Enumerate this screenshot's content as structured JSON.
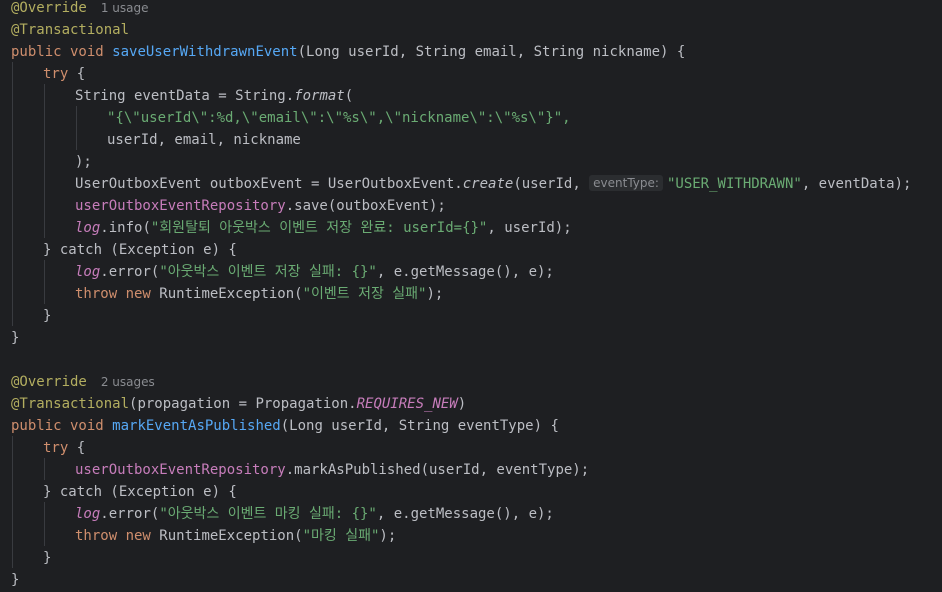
{
  "editor": {
    "method1": {
      "usage_hint": "1 usage",
      "annotations": [
        "@Override",
        "@Transactional"
      ],
      "signature_prefix": "public void ",
      "name": "saveUserWithdrawnEvent",
      "params": "(Long userId, String email, String nickname) {",
      "try_kw": "try",
      "line_eventdata": "String eventData = String.",
      "format_method": "format",
      "json_template": "\"{\\\"userId\\\":%d,\\\"email\\\":\\\"%s\\\",\\\"nickname\\\":\\\"%s\\\"}\",",
      "format_args": "userId, email, nickname",
      "close_paren": ");",
      "outbox_line_prefix": "UserOutboxEvent outboxEvent = UserOutboxEvent.",
      "create_method": "create",
      "create_args_prefix": "(userId, ",
      "param_hint": "eventType:",
      "event_type_literal": "\"USER_WITHDRAWN\"",
      "create_args_suffix": ", eventData);",
      "repo_field": "userOutboxEventRepository",
      "save_call": ".save(outboxEvent);",
      "log_field": "log",
      "info_call": ".info(",
      "info_msg": "\"회원탈퇴 아웃박스 이벤트 저장 완료: userId={}\"",
      "info_args": ", userId);",
      "catch_line": "} catch (Exception e) {",
      "error_call": ".error(",
      "error_msg": "\"아웃박스 이벤트 저장 실패: {}\"",
      "error_args": ", e.getMessage(), e);",
      "throw_line_kw": "throw new ",
      "throw_type": "RuntimeException(",
      "throw_msg": "\"이벤트 저장 실패\"",
      "throw_end": ");"
    },
    "method2": {
      "usage_hint": "2 usages",
      "annotation_override": "@Override",
      "annotation_tx": "@Transactional",
      "tx_args_prefix": "(propagation = Propagation.",
      "tx_const": "REQUIRES_NEW",
      "tx_args_suffix": ")",
      "signature_prefix": "public void ",
      "name": "markEventAsPublished",
      "params": "(Long userId, String eventType) {",
      "try_kw": "try",
      "repo_field": "userOutboxEventRepository",
      "mark_call": ".markAsPublished(userId, eventType);",
      "catch_line": "} catch (Exception e) {",
      "log_field": "log",
      "error_call": ".error(",
      "error_msg": "\"아웃박스 이벤트 마킹 실패: {}\"",
      "error_args": ", e.getMessage(), e);",
      "throw_line_kw": "throw new ",
      "throw_type": "RuntimeException(",
      "throw_msg": "\"마킹 실패\"",
      "throw_end": ");"
    }
  }
}
